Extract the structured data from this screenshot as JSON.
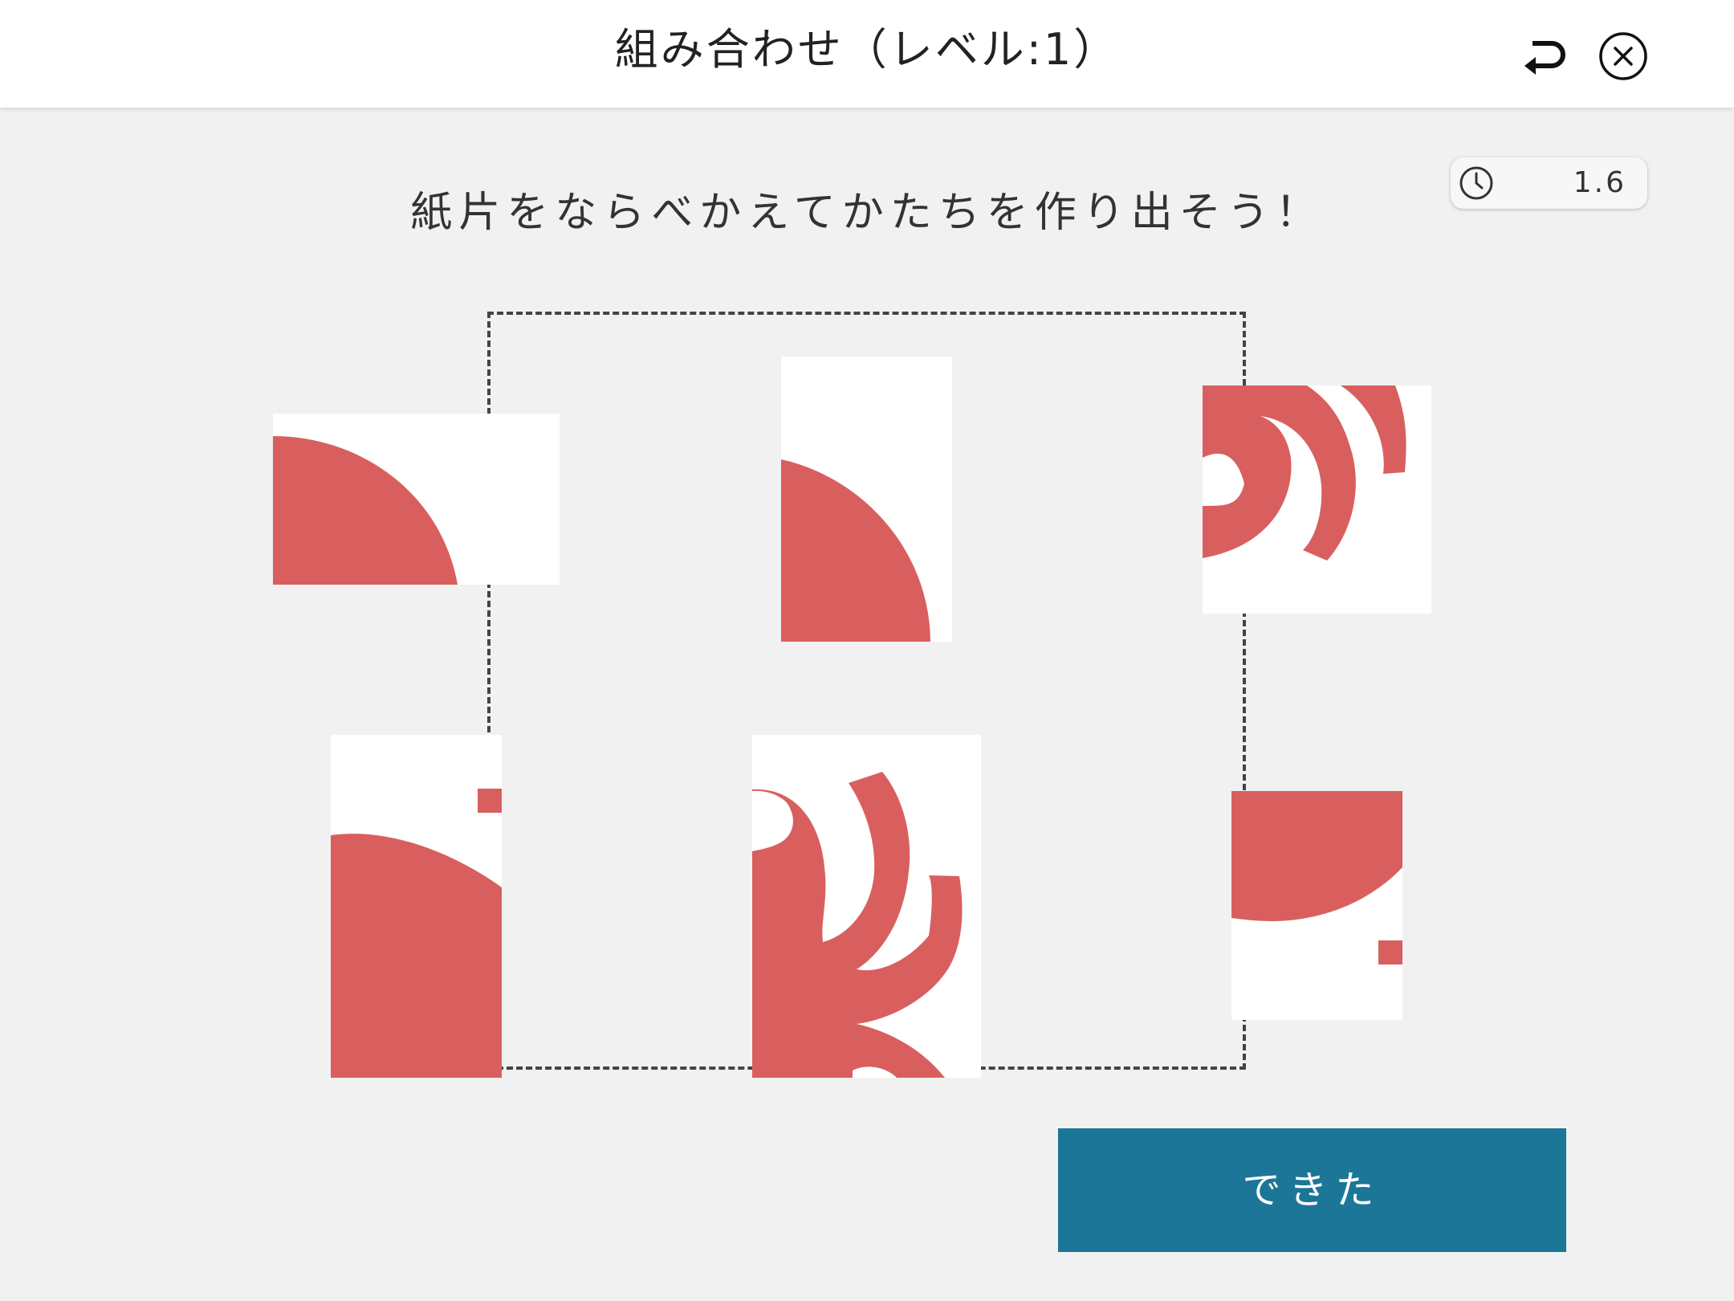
{
  "header": {
    "title": "組み合わせ（レベル:1）",
    "undo_icon": "undo-arrow-icon",
    "close_icon": "close-circle-icon"
  },
  "timer": {
    "icon": "clock-icon",
    "value": "1.6"
  },
  "instruction": "紙片をならべかえてかたちを作り出そう！",
  "puzzle": {
    "piece_count": 6,
    "piece_color": "#ffffff",
    "shape_color": "#d95f5f"
  },
  "done_button": {
    "label": "できた",
    "color": "#1c7697"
  },
  "colors": {
    "background": "#f1f1f1",
    "header": "#ffffff"
  }
}
